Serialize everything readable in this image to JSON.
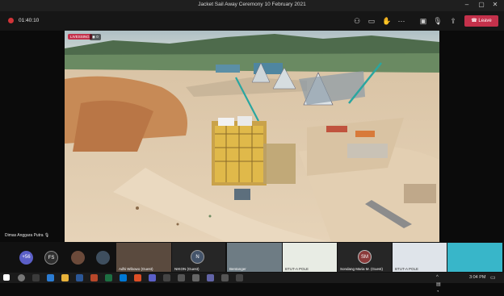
{
  "window": {
    "title": "Jacket Sail Away Ceremony 10 February 2021"
  },
  "toolbar": {
    "timer": "01:40:10",
    "leave_label": "Leave"
  },
  "video": {
    "live_label": "LIVESSING",
    "views": "0"
  },
  "speaker": {
    "name": "Dimas Anggara Putra"
  },
  "participants": {
    "overflow_count": "+56",
    "fs_initials": "FS",
    "n_initials": "N",
    "sm_initials": "SM",
    "tiles": [
      {
        "label": "Adhi Wibowo (Guest)"
      },
      {
        "label": "NIKON (Guest)"
      },
      {
        "label": "Bentanger"
      },
      {
        "label": "BTUT-A POLE"
      },
      {
        "label": "Sondang Maria M. (Guest)"
      },
      {
        "label": "BTUT-A POLE"
      },
      {
        "label": ""
      }
    ]
  },
  "taskbar": {
    "time": "3:04 PM"
  },
  "colors": {
    "leave": "#c4314b",
    "rec": "#d13438"
  }
}
